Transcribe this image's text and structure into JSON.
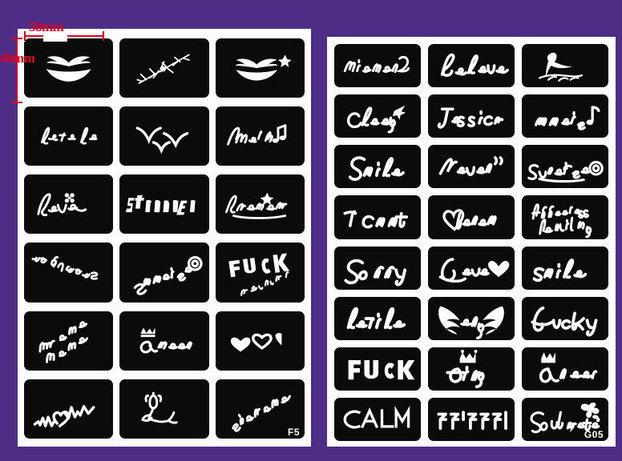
{
  "page": {
    "background_color": "#4d2d85",
    "sheet_color": "#fdfdfd",
    "tile_color": "#0b0b0b",
    "stencil_ink_color": "#ffffff",
    "annotation_color": "#e8001c",
    "description": "Two white stencil sticker sheets of black rounded tiles with white tattoo-stencil designs on a purple background"
  },
  "annotations": {
    "width_label": "58mm",
    "height_label": "48mm"
  },
  "sheets": [
    {
      "id": "left-sheet",
      "code": "F5",
      "columns": 3,
      "rows": 6,
      "tiles": [
        {
          "name": "lips",
          "design": "lips",
          "text": ""
        },
        {
          "name": "thorn-branch",
          "design": "thorn",
          "text": ""
        },
        {
          "name": "lips-with-star",
          "design": "lips-star",
          "text": ""
        },
        {
          "name": "let-it-be",
          "design": "script",
          "text": "let it be"
        },
        {
          "name": "birds",
          "design": "birds",
          "text": ""
        },
        {
          "name": "music",
          "design": "script-notes",
          "text": "Music"
        },
        {
          "name": "love-flower",
          "design": "script-flower",
          "text": "Love"
        },
        {
          "name": "stronger",
          "design": "blackletter",
          "text": "Stronger"
        },
        {
          "name": "dreamer-star",
          "design": "script-star",
          "text": "Dreamer"
        },
        {
          "name": "stand-by-me",
          "design": "script-rotated",
          "text": "stand by me"
        },
        {
          "name": "sunrise",
          "design": "script-swirl",
          "text": "Sunrise"
        },
        {
          "name": "fuck-and-is-forever",
          "design": "block-plus-script",
          "text": "FUCK",
          "subtext": "and is forever"
        },
        {
          "name": "diagonal-script-two-lines",
          "design": "script-diagonal",
          "text": ""
        },
        {
          "name": "queen-crown",
          "design": "script-crown",
          "text": "Queen"
        },
        {
          "name": "three-hearts",
          "design": "hearts",
          "text": ""
        },
        {
          "name": "heartbeat-love",
          "design": "ekg-heart",
          "text": ""
        },
        {
          "name": "rose",
          "design": "rose",
          "text": ""
        },
        {
          "name": "diagonal-script",
          "design": "script-diagonal-single",
          "text": ""
        }
      ]
    },
    {
      "id": "right-sheet",
      "code": "G05",
      "columns": 3,
      "rows": 8,
      "tiles": [
        {
          "name": "miaomiao",
          "design": "script",
          "text": "Miaomiao"
        },
        {
          "name": "believe",
          "design": "script",
          "text": "Believe"
        },
        {
          "name": "seagull",
          "design": "bird-sea",
          "text": ""
        },
        {
          "name": "cheer-plane",
          "design": "script-plane",
          "text": "Cheery"
        },
        {
          "name": "jessica",
          "design": "script",
          "text": "Jessica"
        },
        {
          "name": "music-note",
          "design": "script-note",
          "text": "music"
        },
        {
          "name": "smile-script",
          "design": "script",
          "text": "Smile"
        },
        {
          "name": "never",
          "design": "script-quote",
          "text": "Never"
        },
        {
          "name": "sunrise-swirl",
          "design": "script-swirl",
          "text": "Sunrise"
        },
        {
          "name": "i-cant",
          "design": "script",
          "text": "I can't"
        },
        {
          "name": "heart-dream",
          "design": "heart-script",
          "text": "Dream"
        },
        {
          "name": "happiness-delight",
          "design": "script-two-lines",
          "text": "Happiness",
          "subtext": "Delight"
        },
        {
          "name": "sorry",
          "design": "script",
          "text": "Sorry"
        },
        {
          "name": "love-heart",
          "design": "script-heart",
          "text": "Love"
        },
        {
          "name": "smile-lower",
          "design": "script",
          "text": "smile"
        },
        {
          "name": "let-it-be-right",
          "design": "script",
          "text": "let it be"
        },
        {
          "name": "angel-wings",
          "design": "wings-script",
          "text": "Angel"
        },
        {
          "name": "lucky",
          "design": "script",
          "text": "Lucky"
        },
        {
          "name": "fuck-block",
          "design": "block",
          "text": "FUCK"
        },
        {
          "name": "king-crown",
          "design": "script-crown",
          "text": "King"
        },
        {
          "name": "queen-crown-right",
          "design": "script-crown",
          "text": "Queen"
        },
        {
          "name": "calm",
          "design": "thin-caps",
          "text": "CALM"
        },
        {
          "name": "tibetan-script",
          "design": "tibetan",
          "text": "ཨཨ་ཨཨཨ།"
        },
        {
          "name": "soul-mate-butterfly",
          "design": "script-butterfly",
          "text": "Soul mate"
        }
      ]
    }
  ]
}
